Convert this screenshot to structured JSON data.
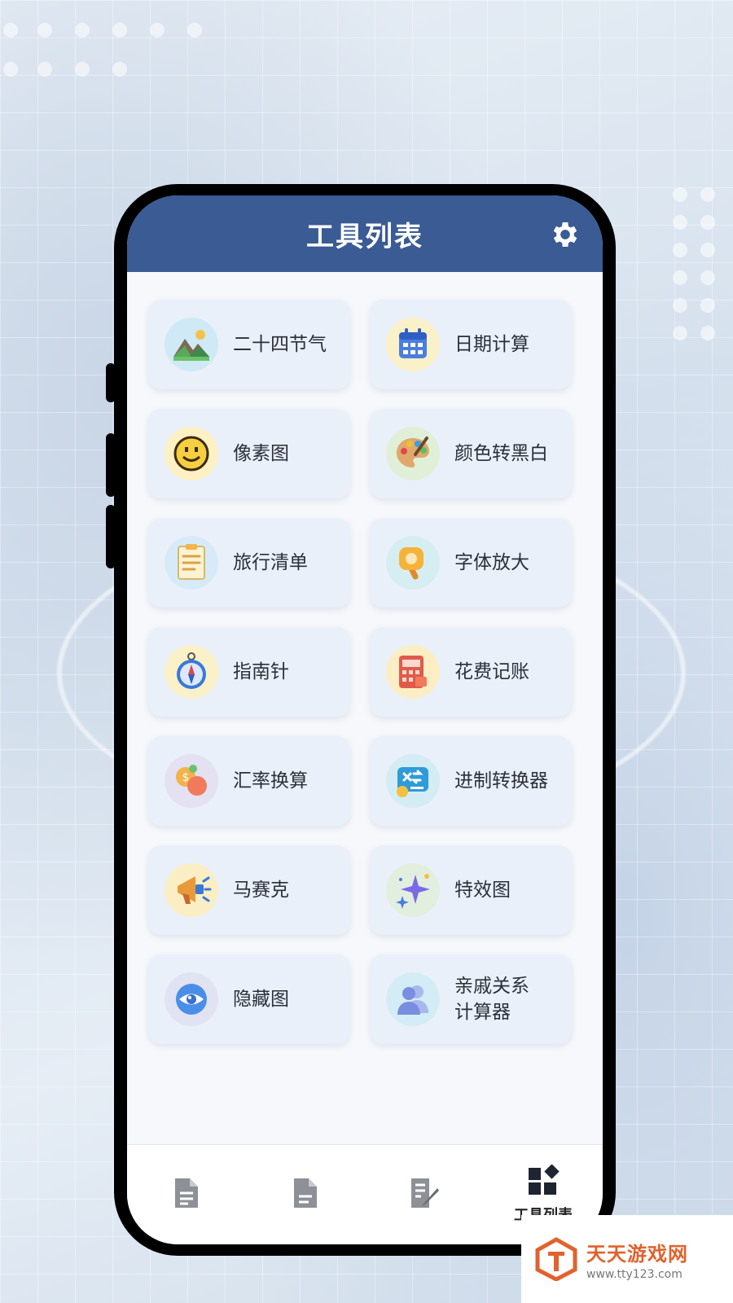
{
  "header": {
    "title": "工具列表"
  },
  "tools": [
    {
      "label": "二十四节气",
      "icon": "landscape-icon",
      "bg": "#cfe9f6"
    },
    {
      "label": "日期计算",
      "icon": "calendar-icon",
      "bg": "#fbf1c8"
    },
    {
      "label": "像素图",
      "icon": "smiley-icon",
      "bg": "#fdf0c2"
    },
    {
      "label": "颜色转黑白",
      "icon": "palette-icon",
      "bg": "#e0efd8"
    },
    {
      "label": "旅行清单",
      "icon": "checklist-icon",
      "bg": "#d6ebf7"
    },
    {
      "label": "字体放大",
      "icon": "magnifier-icon",
      "bg": "#d6eef2"
    },
    {
      "label": "指南针",
      "icon": "compass-icon",
      "bg": "#fbf1c8"
    },
    {
      "label": "花费记账",
      "icon": "ledger-icon",
      "bg": "#fbeec4"
    },
    {
      "label": "汇率换算",
      "icon": "exchange-icon",
      "bg": "#e3e1f2"
    },
    {
      "label": "进制转换器",
      "icon": "converter-icon",
      "bg": "#d4ecf3"
    },
    {
      "label": "马赛克",
      "icon": "megaphone-icon",
      "bg": "#fbeec4"
    },
    {
      "label": "特效图",
      "icon": "sparkle-icon",
      "bg": "#e2efdf"
    },
    {
      "label": "隐藏图",
      "icon": "eye-icon",
      "bg": "#e1e3f2"
    },
    {
      "label": "亲戚关系\n计算器",
      "icon": "people-icon",
      "bg": "#d4ecf5"
    }
  ],
  "bottom_nav": [
    {
      "icon": "document-icon",
      "label": ""
    },
    {
      "icon": "file-icon",
      "label": ""
    },
    {
      "icon": "edit-icon",
      "label": ""
    },
    {
      "icon": "tools-grid-icon",
      "label": "工具列表",
      "active": true
    }
  ],
  "watermark": {
    "name": "天天游戏网",
    "url": "www.tty123.com"
  },
  "colors": {
    "appbar": "#3a5b93",
    "card": "#eaf0f9",
    "watermark": "#e0622e"
  }
}
